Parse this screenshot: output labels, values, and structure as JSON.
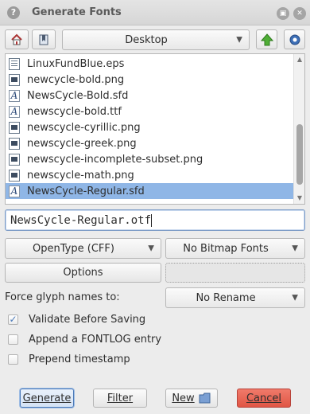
{
  "window": {
    "title": "Generate Fonts"
  },
  "toolbar": {
    "location": "Desktop"
  },
  "files": [
    {
      "name": "LinuxFundBlue.eps",
      "icon": "document-icon",
      "kind": "doc"
    },
    {
      "name": "newcycle-bold.png",
      "icon": "image-file-icon",
      "kind": "img"
    },
    {
      "name": "NewsCycle-Bold.sfd",
      "icon": "font-file-icon",
      "kind": "font"
    },
    {
      "name": "newscycle-bold.ttf",
      "icon": "font-file-icon",
      "kind": "font"
    },
    {
      "name": "newscycle-cyrillic.png",
      "icon": "image-file-icon",
      "kind": "img"
    },
    {
      "name": "newscycle-greek.png",
      "icon": "image-file-icon",
      "kind": "img"
    },
    {
      "name": "newscycle-incomplete-subset.png",
      "icon": "image-file-icon",
      "kind": "img"
    },
    {
      "name": "newscycle-math.png",
      "icon": "image-file-icon",
      "kind": "img"
    },
    {
      "name": "NewsCycle-Regular.sfd",
      "icon": "font-file-icon",
      "kind": "font",
      "selected": true
    }
  ],
  "filename": {
    "value": "NewsCycle-Regular.otf"
  },
  "format": {
    "outline": "OpenType (CFF)",
    "bitmap": "No Bitmap Fonts"
  },
  "options_button": "Options",
  "glyph_names": {
    "label": "Force glyph names to:",
    "value": "No Rename"
  },
  "checks": [
    {
      "label": "Validate Before Saving",
      "checked": true
    },
    {
      "label": "Append a FONTLOG entry",
      "checked": false
    },
    {
      "label": "Prepend timestamp",
      "checked": false
    }
  ],
  "buttons": {
    "generate": "Generate",
    "filter": "Filter",
    "new": "New",
    "cancel": "Cancel"
  },
  "colors": {
    "selection": "#8fb6e6",
    "accent_blue": "#4a79b8",
    "cancel_red": "#e5604f"
  }
}
